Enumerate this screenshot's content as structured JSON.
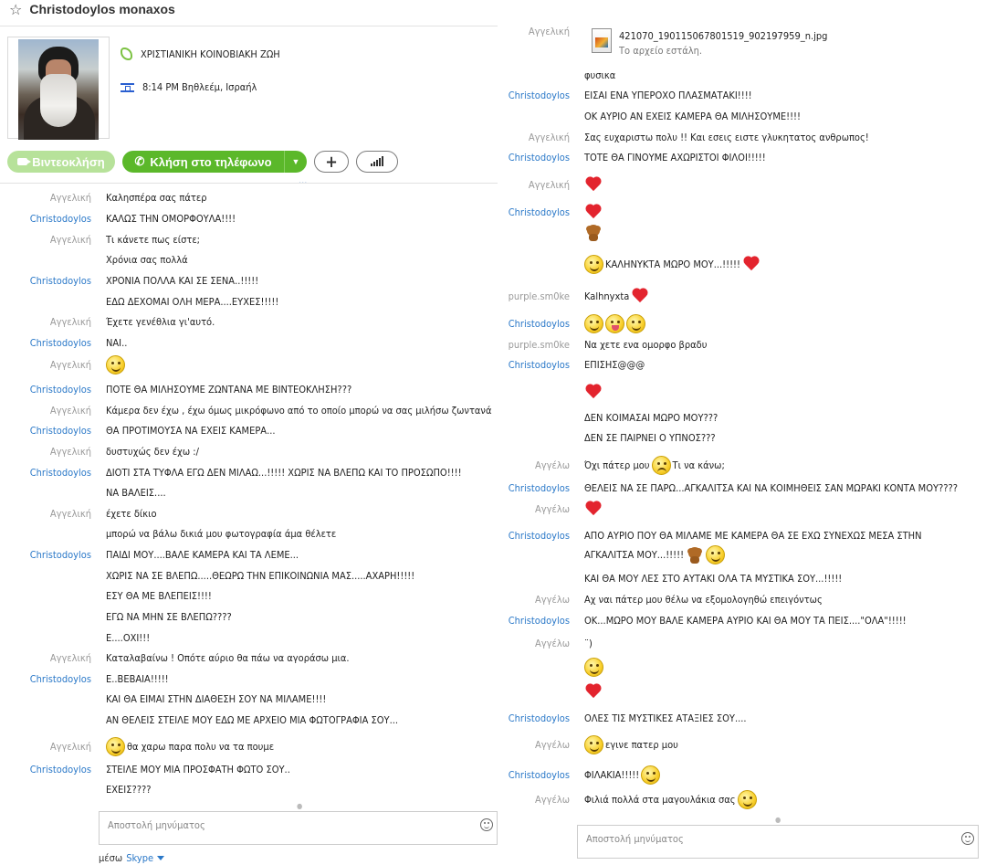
{
  "header": {
    "contact_name": "Christodoylos monaxos",
    "mood": "ΧΡΙΣΤΙΑΝΙΚΗ ΚΟΙΝΟΒΙΑΚΗ ΖΩΗ",
    "location": "8:14 PM Βηθλεέμ, Ισραήλ",
    "mood_icon_color": "#7cc242"
  },
  "buttons": {
    "video": "Βιντεοκλήση",
    "call": "Κλήση στο τηλέφωνο",
    "add": "+",
    "more_dots": "..."
  },
  "colors": {
    "sender_a": "#999999",
    "sender_c": "#2a78c8",
    "call_green": "#5bb82a",
    "video_green_disabled": "#b7e29a"
  },
  "senders": {
    "aggeliki": "Αγγελική",
    "christodoylos": "Christodoylos",
    "purple": "purple.sm0ke",
    "aggelo": "Αγγέλω"
  },
  "left_messages": [
    {
      "sender": "Αγγελική",
      "cls": "s-a",
      "text": "Καλησπέρα σας πάτερ",
      "parts": []
    },
    {
      "sender": "Christodoylos",
      "cls": "s-c",
      "text": "ΚΑΛΩΣ ΤΗΝ ΟΜΟΡΦΟΥΛΑ!!!!",
      "parts": []
    },
    {
      "sender": "Αγγελική",
      "cls": "s-a",
      "text": "Τι κάνετε πως είστε;",
      "parts": []
    },
    {
      "sender": "",
      "cls": "s-a",
      "text": "Χρόνια σας πολλά",
      "parts": []
    },
    {
      "sender": "Christodoylos",
      "cls": "s-c",
      "text": "ΧΡΟΝΙΑ ΠΟΛΛΑ ΚΑΙ ΣΕ ΣΕΝΑ..!!!!!",
      "parts": []
    },
    {
      "sender": "",
      "cls": "s-c",
      "text": "ΕΔΩ ΔΕΧΟΜΑΙ ΟΛΗ ΜΕΡΑ....ΕΥΧΕΣ!!!!!",
      "parts": []
    },
    {
      "sender": "Αγγελική",
      "cls": "s-a",
      "text": "Έχετε γενέθλια γι'αυτό.",
      "parts": []
    },
    {
      "sender": "Christodoylos",
      "cls": "s-c",
      "text": "ΝΑΙ..",
      "parts": []
    },
    {
      "sender": "Αγγελική",
      "cls": "s-a",
      "text": "",
      "parts": [
        "smile"
      ]
    },
    {
      "sender": "Christodoylos",
      "cls": "s-c",
      "text": "ΠΟΤΕ ΘΑ ΜΙΛΗΣΟΥΜΕ ΖΩΝΤΑΝΑ ΜΕ ΒΙΝΤΕΟΚΛΗΣΗ???",
      "parts": []
    },
    {
      "sender": "Αγγελική",
      "cls": "s-a",
      "text": "Κάμερα δεν έχω , έχω όμως μικρόφωνο από το οποίο μπορώ να σας μιλήσω ζωντανά",
      "parts": []
    },
    {
      "sender": "Christodoylos",
      "cls": "s-c",
      "text": "ΘΑ ΠΡΟΤΙΜΟΥΣΑ ΝΑ ΕΧΕΙΣ ΚΑΜΕΡΑ...",
      "parts": []
    },
    {
      "sender": "Αγγελική",
      "cls": "s-a",
      "text": "δυστυχώς δεν έχω :/",
      "parts": []
    },
    {
      "sender": "Christodoylos",
      "cls": "s-c",
      "text": "ΔΙΟΤΙ ΣΤΑ ΤΥΦΛΑ ΕΓΩ ΔΕΝ ΜΙΛΑΩ...!!!!! ΧΩΡΙΣ ΝΑ ΒΛΕΠΩ ΚΑΙ ΤΟ ΠΡΟΣΩΠΟ!!!!",
      "parts": []
    },
    {
      "sender": "",
      "cls": "s-c",
      "text": "ΝΑ ΒΑΛΕΙΣ....",
      "parts": []
    },
    {
      "sender": "Αγγελική",
      "cls": "s-a",
      "text": "έχετε δίκιο",
      "parts": []
    },
    {
      "sender": "",
      "cls": "s-a",
      "text": "μπορώ να βάλω δικιά μου φωτογραφία άμα θέλετε",
      "parts": []
    },
    {
      "sender": "Christodoylos",
      "cls": "s-c",
      "text": "ΠΑΙΔΙ ΜΟΥ....ΒΑΛΕ ΚΑΜΕΡΑ ΚΑΙ ΤΑ ΛΕΜΕ...",
      "parts": []
    },
    {
      "sender": "",
      "cls": "s-c",
      "text": "ΧΩΡΙΣ ΝΑ ΣΕ ΒΛΕΠΩ.....ΘΕΩΡΩ ΤΗΝ ΕΠΙΚΟΙΝΩΝΙΑ ΜΑΣ.....ΑΧΑΡΗ!!!!!",
      "parts": []
    },
    {
      "sender": "",
      "cls": "s-c",
      "text": "ΕΣΥ ΘΑ ΜΕ ΒΛΕΠΕΙΣ!!!!",
      "parts": []
    },
    {
      "sender": "",
      "cls": "s-c",
      "text": "ΕΓΩ ΝΑ ΜΗΝ ΣΕ ΒΛΕΠΩ????",
      "parts": []
    },
    {
      "sender": "",
      "cls": "s-c",
      "text": "Ε....ΟΧΙ!!!",
      "parts": []
    },
    {
      "sender": "Αγγελική",
      "cls": "s-a",
      "text": "Καταλαβαίνω ! Οπότε αύριο θα πάω να αγοράσω μια.",
      "parts": []
    },
    {
      "sender": "Christodoylos",
      "cls": "s-c",
      "text": "Ε..ΒΕΒΑΙΑ!!!!!",
      "parts": []
    },
    {
      "sender": "",
      "cls": "s-c",
      "text": "ΚΑΙ ΘΑ ΕΙΜΑΙ ΣΤΗΝ ΔΙΑΘΕΣΗ ΣΟΥ ΝΑ ΜΙΛΑΜΕ!!!!",
      "parts": []
    },
    {
      "sender": "",
      "cls": "s-c",
      "text": "ΑΝ ΘΕΛΕΙΣ ΣΤΕΙΛΕ ΜΟΥ ΕΔΩ ΜΕ ΑΡΧΕΙΟ ΜΙΑ ΦΩΤΟΓΡΑΦΙΑ ΣΟΥ...",
      "parts": []
    },
    {
      "sender": "Αγγελική",
      "cls": "s-a",
      "text": "θα χαρω παρα πολυ να τα πουμε",
      "parts": [
        "smile-before"
      ]
    },
    {
      "sender": "Christodoylos",
      "cls": "s-c",
      "text": "ΣΤΕΙΛΕ ΜΟΥ ΜΙΑ ΠΡΟΣΦΑΤΗ ΦΩΤΟ ΣΟΥ..",
      "parts": []
    },
    {
      "sender": "",
      "cls": "s-c",
      "text": "ΕΧΕΙΣ????",
      "parts": []
    }
  ],
  "file": {
    "sender": "Αγγελική",
    "name": "421070_190115067801519_902197959_n.jpg",
    "status": "Το αρχείο εστάλη."
  },
  "right_messages": [
    {
      "sender": "",
      "cls": "s-a",
      "text": "φυσικα",
      "parts": []
    },
    {
      "sender": "Christodoylos",
      "cls": "s-c",
      "text": "ΕΙΣΑΙ ΕΝΑ ΥΠΕΡΟΧΟ ΠΛΑΣΜΑΤΑΚΙ!!!!",
      "parts": []
    },
    {
      "sender": "",
      "cls": "s-c",
      "text": "ΟΚ ΑΥΡΙΟ ΑΝ ΕΧΕΙΣ ΚΑΜΕΡΑ ΘΑ ΜΙΛΗΣΟΥΜΕ!!!!",
      "parts": []
    },
    {
      "sender": "Αγγελική",
      "cls": "s-a",
      "text": "Σας ευχαριστω πολυ !! Και εσεις ειστε γλυκητατος ανθρωπος!",
      "parts": []
    },
    {
      "sender": "Christodoylos",
      "cls": "s-c",
      "text": "ΤΟΤΕ ΘΑ ΓΙΝΟΥΜΕ ΑΧΩΡΙΣΤΟΙ ΦΙΛΟΙ!!!!!",
      "parts": []
    },
    {
      "sender": "Αγγελική",
      "cls": "s-a",
      "text": "",
      "parts": [
        "heart"
      ]
    },
    {
      "sender": "Christodoylos",
      "cls": "s-c",
      "text": "",
      "parts": [
        "heart"
      ]
    },
    {
      "sender": "",
      "cls": "s-c",
      "text": "",
      "parts": [
        "bear"
      ]
    },
    {
      "sender": "",
      "cls": "s-c",
      "text": "ΚΑΛΗΝΥΚΤΑ ΜΩΡΟ ΜΟΥ...!!!!!",
      "parts": [
        "smile-before",
        "heart-after"
      ]
    },
    {
      "sender": "purple.sm0ke",
      "cls": "s-p",
      "text": "Kalhnyxta",
      "parts": [
        "heart-after"
      ]
    },
    {
      "sender": "Christodoylos",
      "cls": "s-c",
      "text": "",
      "parts": [
        "smile",
        "tongue",
        "smile"
      ]
    },
    {
      "sender": "purple.sm0ke",
      "cls": "s-p",
      "text": "Να χετε ενα ομορφο βραδυ",
      "parts": []
    },
    {
      "sender": "Christodoylos",
      "cls": "s-c",
      "text": "ΕΠΙΣΗΣ@@@",
      "parts": []
    },
    {
      "sender": "",
      "cls": "s-c",
      "text": "",
      "parts": [
        "heart"
      ]
    },
    {
      "sender": "",
      "cls": "s-c",
      "text": "ΔΕΝ ΚΟΙΜΑΣΑΙ ΜΩΡΟ ΜΟΥ???",
      "parts": []
    },
    {
      "sender": "",
      "cls": "s-c",
      "text": "ΔΕΝ ΣΕ ΠΑΙΡΝΕΙ Ο ΥΠΝΟΣ???",
      "parts": []
    },
    {
      "sender": "Αγγέλω",
      "cls": "s-a",
      "text": "Όχι πάτερ μου",
      "parts": [
        "sad-after"
      ],
      "text2": "Τι να κάνω;"
    },
    {
      "sender": "Christodoylos",
      "cls": "s-c",
      "text": "ΘΕΛΕΙΣ ΝΑ ΣΕ ΠΑΡΩ...ΑΓΚΑΛΙΤΣΑ ΚΑΙ ΝΑ ΚΟΙΜΗΘΕΙΣ ΣΑΝ ΜΩΡΑΚΙ ΚΟΝΤΑ ΜΟΥ????",
      "parts": []
    },
    {
      "sender": "Αγγέλω",
      "cls": "s-a",
      "text": "",
      "parts": [
        "heart"
      ]
    },
    {
      "sender": "Christodoylos",
      "cls": "s-c",
      "text": "ΑΠΟ ΑΥΡΙΟ ΠΟΥ ΘΑ ΜΙΛΑΜΕ ΜΕ ΚΑΜΕΡΑ ΘΑ ΣΕ ΕΧΩ ΣΥΝΕΧΩΣ ΜΕΣΑ ΣΤΗΝ",
      "parts": []
    },
    {
      "sender": "",
      "cls": "s-c",
      "text": "ΑΓΚΑΛΙΤΣΑ ΜΟΥ...!!!!!",
      "parts": [
        "bear-after",
        "smile-after"
      ]
    },
    {
      "sender": "",
      "cls": "s-c",
      "text": "ΚΑΙ ΘΑ ΜΟΥ ΛΕΣ ΣΤΟ ΑΥΤΑΚΙ ΟΛΑ ΤΑ ΜΥΣΤΙΚΑ ΣΟΥ...!!!!!",
      "parts": []
    },
    {
      "sender": "Αγγέλω",
      "cls": "s-a",
      "text": "Αχ ναι πάτερ μου θέλω να εξομολογηθώ επειγόντως",
      "parts": []
    },
    {
      "sender": "Christodoylos",
      "cls": "s-c",
      "text": "ΟΚ...ΜΩΡΟ ΜΟΥ ΒΑΛΕ ΚΑΜΕΡΑ ΑΥΡΙΟ ΚΑΙ ΘΑ ΜΟΥ ΤΑ ΠΕΙΣ....\"ΟΛΑ\"!!!!!",
      "parts": []
    },
    {
      "sender": "Αγγέλω",
      "cls": "s-a",
      "text": "¨)",
      "parts": []
    },
    {
      "sender": "",
      "cls": "s-a",
      "text": "",
      "parts": [
        "smile"
      ]
    },
    {
      "sender": "",
      "cls": "s-a",
      "text": "",
      "parts": [
        "heart"
      ]
    },
    {
      "sender": "Christodoylos",
      "cls": "s-c",
      "text": "ΟΛΕΣ ΤΙΣ ΜΥΣΤΙΚΕΣ ΑΤΑΞΙΕΣ ΣΟΥ....",
      "parts": []
    },
    {
      "sender": "Αγγέλω",
      "cls": "s-a",
      "text": "εγινε πατερ μου",
      "parts": [
        "smile-before"
      ]
    },
    {
      "sender": "Christodoylos",
      "cls": "s-c",
      "text": "ΦΙΛΑΚΙΑ!!!!!",
      "parts": [
        "smile-after"
      ]
    },
    {
      "sender": "Αγγέλω",
      "cls": "s-a",
      "text": "Φιλιά πολλά στα μαγουλάκια σας",
      "parts": [
        "smile-after"
      ]
    }
  ],
  "input": {
    "placeholder": "Αποστολή μηνύματος"
  },
  "footer": {
    "via": "μέσω",
    "skype": "Skype"
  }
}
